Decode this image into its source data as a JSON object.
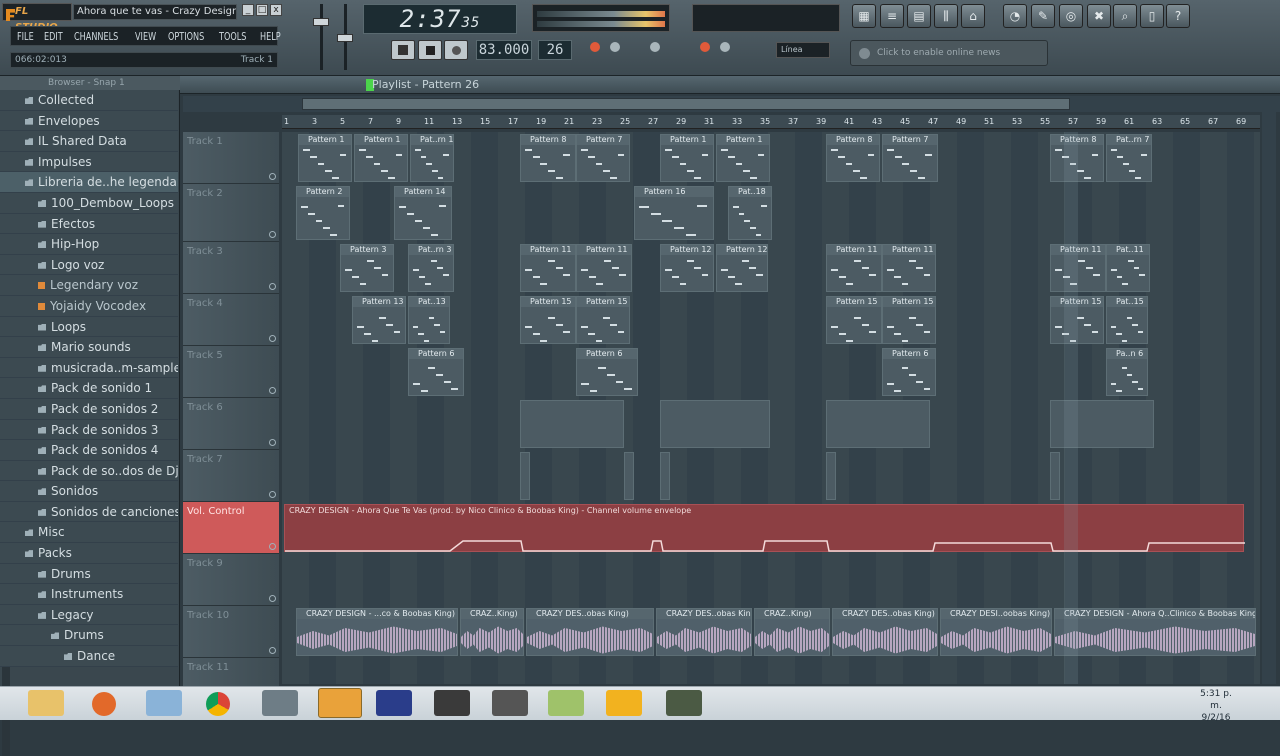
{
  "window": {
    "logo": "FL STUDIO",
    "title": "Ahora que te vas - Crazy Design",
    "wbtns": [
      "_",
      "□",
      "x"
    ]
  },
  "menu": [
    "FILE",
    "EDIT",
    "CHANNELS",
    "VIEW",
    "OPTIONS",
    "TOOLS",
    "HELP"
  ],
  "position": {
    "value": "066:02:013",
    "track": "Track 1"
  },
  "transport": {
    "time": "2:37",
    "time_small": "35",
    "tempo": "83.000",
    "pattern": "26",
    "snap": "Línea"
  },
  "online": "Click to enable online news",
  "browser": {
    "header": "Browser - Snap 1",
    "items": [
      {
        "label": "Collected",
        "type": "folder",
        "indent": 1
      },
      {
        "label": "Envelopes",
        "type": "folder",
        "indent": 1
      },
      {
        "label": "IL Shared Data",
        "type": "folder",
        "indent": 1
      },
      {
        "label": "Impulses",
        "type": "folder",
        "indent": 1
      },
      {
        "label": "Libreria de..he legendary",
        "type": "folder",
        "indent": 1,
        "selected": true
      },
      {
        "label": "100_Dembow_Loops",
        "type": "folder",
        "indent": 2
      },
      {
        "label": "Efectos",
        "type": "folder",
        "indent": 2
      },
      {
        "label": "Hip-Hop",
        "type": "folder",
        "indent": 2
      },
      {
        "label": "Logo voz",
        "type": "folder",
        "indent": 2
      },
      {
        "label": "Legendary voz",
        "type": "file",
        "indent": 2
      },
      {
        "label": "Yojaidy Vocodex",
        "type": "file",
        "indent": 2
      },
      {
        "label": "Loops",
        "type": "folder",
        "indent": 2
      },
      {
        "label": "Mario sounds",
        "type": "folder",
        "indent": 2
      },
      {
        "label": "musicrada..m-samples",
        "type": "folder",
        "indent": 2
      },
      {
        "label": "Pack de sonido 1",
        "type": "folder",
        "indent": 2
      },
      {
        "label": "Pack de sonidos 2",
        "type": "folder",
        "indent": 2
      },
      {
        "label": "Pack de sonidos 3",
        "type": "folder",
        "indent": 2
      },
      {
        "label": "Pack de sonidos 4",
        "type": "folder",
        "indent": 2
      },
      {
        "label": "Pack de so..dos de Djs",
        "type": "folder",
        "indent": 2
      },
      {
        "label": "Sonidos",
        "type": "folder",
        "indent": 2
      },
      {
        "label": "Sonidos de canciones",
        "type": "folder",
        "indent": 2
      },
      {
        "label": "Misc",
        "type": "folder",
        "indent": 1
      },
      {
        "label": "Packs",
        "type": "folder",
        "indent": 1
      },
      {
        "label": "Drums",
        "type": "folder",
        "indent": 2
      },
      {
        "label": "Instruments",
        "type": "folder",
        "indent": 2
      },
      {
        "label": "Legacy",
        "type": "folder",
        "indent": 2
      },
      {
        "label": "Drums",
        "type": "folder",
        "indent": 3
      },
      {
        "label": "Dance",
        "type": "folder",
        "indent": 4
      }
    ]
  },
  "playlist": {
    "title": "Playlist - Pattern 26",
    "ruler": [
      "1",
      "3",
      "5",
      "7",
      "9",
      "11",
      "13",
      "15",
      "17",
      "19",
      "21",
      "23",
      "25",
      "27",
      "29",
      "31",
      "33",
      "35",
      "37",
      "39",
      "41",
      "43",
      "45",
      "47",
      "49",
      "51",
      "53",
      "55",
      "57",
      "59",
      "61",
      "63",
      "65",
      "67",
      "69"
    ],
    "tracks": [
      "Track 1",
      "Track 2",
      "Track 3",
      "Track 4",
      "Track 5",
      "Track 6",
      "Track 7",
      "Vol. Control",
      "Track 9",
      "Track 10",
      "Track 11"
    ],
    "vol_clip": "CRAZY DESIGN - Ahora Que Te Vas (prod. by Nico Clinico & Boobas King) - Channel volume envelope",
    "audio_clips": [
      "CRAZY DESIGN - ...co & Boobas King)",
      "CRAZ..King)",
      "CRAZY DES..obas King)",
      "CRAZY DES..obas King)",
      "CRAZ..King)",
      "CRAZY DES..obas King)",
      "CRAZY DESI..oobas King)",
      "CRAZY DESIGN - Ahora Q..Clinico & Boobas King)"
    ]
  },
  "clips": [
    {
      "t": 0,
      "c": "Pattern 1"
    },
    {
      "t": 0,
      "c": "Pattern 1"
    },
    {
      "t": 0,
      "c": "Pat..rn 1"
    },
    {
      "t": 0,
      "c": "Pattern 8"
    },
    {
      "t": 0,
      "c": "Pattern 7"
    },
    {
      "t": 0,
      "c": "Pattern 1"
    },
    {
      "t": 0,
      "c": "Pattern 1"
    },
    {
      "t": 0,
      "c": "Pattern 8"
    },
    {
      "t": 0,
      "c": "Pattern 7"
    },
    {
      "t": 0,
      "c": "Pattern 8"
    },
    {
      "t": 0,
      "c": "Pat..rn 7"
    },
    {
      "t": 1,
      "c": "Pattern 2"
    },
    {
      "t": 1,
      "c": "Pattern 14"
    },
    {
      "t": 1,
      "c": "Pattern 16"
    },
    {
      "t": 1,
      "c": "Pat..18"
    },
    {
      "t": 2,
      "c": "Pattern 3"
    },
    {
      "t": 2,
      "c": "Pat..rn 3"
    },
    {
      "t": 2,
      "c": "Pattern 11"
    },
    {
      "t": 2,
      "c": "Pattern 11"
    },
    {
      "t": 2,
      "c": "Pattern 12"
    },
    {
      "t": 2,
      "c": "Pattern 12"
    },
    {
      "t": 2,
      "c": "Pattern 11"
    },
    {
      "t": 2,
      "c": "Pattern 11"
    },
    {
      "t": 2,
      "c": "Pattern 11"
    },
    {
      "t": 2,
      "c": "Pat..11"
    },
    {
      "t": 3,
      "c": "Pattern 13"
    },
    {
      "t": 3,
      "c": "Pat..13"
    },
    {
      "t": 3,
      "c": "Pattern 15"
    },
    {
      "t": 3,
      "c": "Pattern 15"
    },
    {
      "t": 3,
      "c": "Pattern 15"
    },
    {
      "t": 3,
      "c": "Pattern 15"
    },
    {
      "t": 3,
      "c": "Pattern 15"
    },
    {
      "t": 3,
      "c": "Pat..15"
    },
    {
      "t": 4,
      "c": "Pattern 6"
    },
    {
      "t": 4,
      "c": "Pattern 6"
    },
    {
      "t": 4,
      "c": "Pattern 6"
    },
    {
      "t": 4,
      "c": "Pa..n 6"
    }
  ],
  "taskbar": {
    "clock_time": "5:31 p. m.",
    "clock_date": "9/2/16"
  }
}
